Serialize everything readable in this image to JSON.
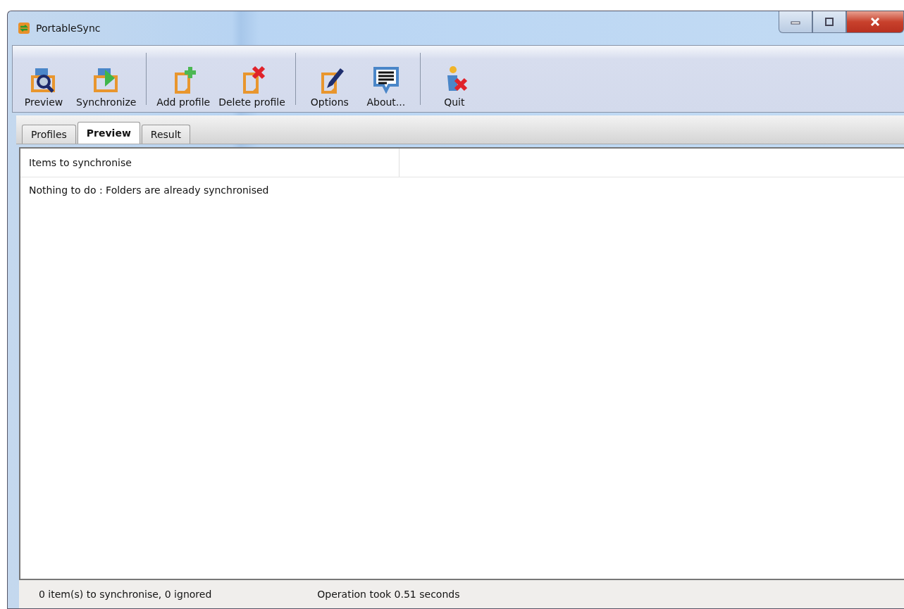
{
  "window": {
    "title": "PortableSync"
  },
  "toolbar": {
    "groups": [
      {
        "buttons": [
          {
            "label": "Preview",
            "kind": "preview"
          },
          {
            "label": "Synchronize",
            "kind": "sync"
          }
        ]
      },
      {
        "buttons": [
          {
            "label": "Add profile",
            "kind": "add"
          },
          {
            "label": "Delete profile",
            "kind": "delete"
          }
        ]
      },
      {
        "buttons": [
          {
            "label": "Options",
            "kind": "options"
          },
          {
            "label": "About...",
            "kind": "about"
          }
        ]
      },
      {
        "buttons": [
          {
            "label": "Quit",
            "kind": "quit"
          }
        ]
      }
    ]
  },
  "tabs": [
    {
      "label": "Profiles",
      "selected": false
    },
    {
      "label": "Preview",
      "selected": true
    },
    {
      "label": "Result",
      "selected": false
    }
  ],
  "list": {
    "columns": [
      "Items to synchronise"
    ],
    "rows": [
      "Nothing to do : Folders are already synchronised"
    ]
  },
  "status_bar": [
    "0 item(s) to synchronise, 0 ignored",
    "Operation took 0.51 seconds"
  ]
}
